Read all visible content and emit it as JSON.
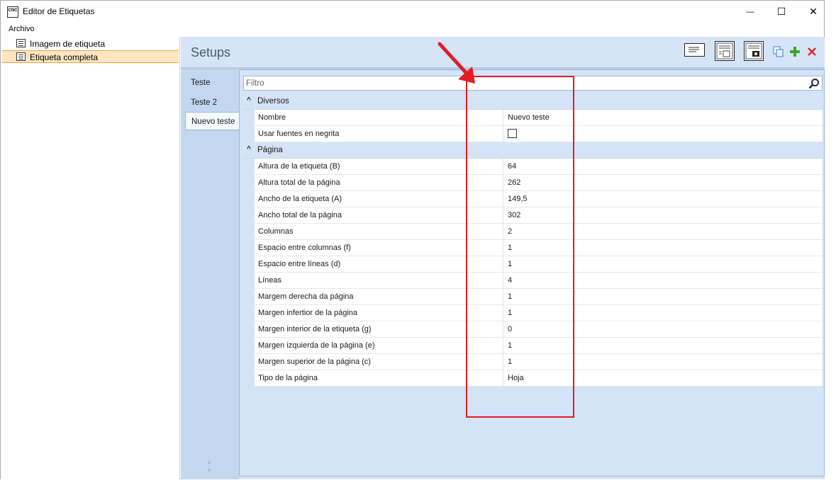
{
  "window": {
    "title": "Editor de Etiquetas",
    "app_icon_text_top": "CNC",
    "minimize_glyph": "—",
    "maximize_glyph": "☐",
    "close_glyph": "✕"
  },
  "menu": {
    "items": [
      "Archivo"
    ]
  },
  "sidebar": {
    "items": [
      {
        "label": "Imagem de etiqueta",
        "icon": "label-image-icon",
        "selected": false
      },
      {
        "label": "Etiqueta completa",
        "icon": "full-label-icon",
        "selected": true
      }
    ]
  },
  "header": {
    "title": "Setups",
    "toolbar": [
      "label-layout-icon",
      "page-layout-icon",
      "photo-layout-icon",
      "copy-icon",
      "add-icon",
      "delete-icon"
    ]
  },
  "tabs": [
    {
      "label": "Teste",
      "active": false
    },
    {
      "label": "Teste 2",
      "active": false
    },
    {
      "label": "Nuevo teste",
      "active": true
    }
  ],
  "filter": {
    "placeholder": "Filtro",
    "value": ""
  },
  "categories": [
    {
      "label": "Diversos",
      "rows": [
        {
          "name": "Nombre",
          "value": "Nuevo teste"
        },
        {
          "name": "Usar fuentes en negrita",
          "value": "",
          "checkbox": true,
          "checked": false
        }
      ]
    },
    {
      "label": "Página",
      "rows": [
        {
          "name": "Altura de la etiqueta (B)",
          "value": "64"
        },
        {
          "name": "Altura total de la página",
          "value": "262"
        },
        {
          "name": "Ancho de la etiqueta (A)",
          "value": "149,5"
        },
        {
          "name": "Ancho total de la página",
          "value": "302"
        },
        {
          "name": "Columnas",
          "value": "2"
        },
        {
          "name": "Espacio entre columnas (f)",
          "value": "1"
        },
        {
          "name": "Espacio entre líneas (d)",
          "value": "1"
        },
        {
          "name": "Líneas",
          "value": "4"
        },
        {
          "name": "Margem derecha da página",
          "value": "1"
        },
        {
          "name": "Margen infertior de la página",
          "value": "1"
        },
        {
          "name": "Margen interior de la etiqueta (g)",
          "value": "0"
        },
        {
          "name": "Margen izquierda de la página (e)",
          "value": "1"
        },
        {
          "name": "Margen superior de la página (c)",
          "value": "1"
        },
        {
          "name": "Tipo de la página",
          "value": "Hoja"
        }
      ]
    }
  ],
  "colors": {
    "annotation": "#e31c23",
    "selection": "#fde6c0",
    "add": "#3aa32a",
    "delete": "#e02a2a"
  }
}
